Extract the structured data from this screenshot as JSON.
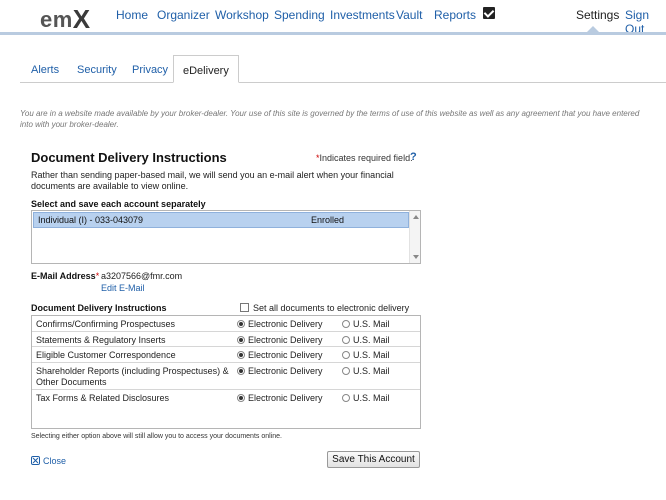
{
  "brand": {
    "logo_text": "em",
    "logo_x": "X"
  },
  "nav": {
    "home": "Home",
    "organizer": "Organizer",
    "workshop": "Workshop",
    "spending": "Spending",
    "investments": "Investments",
    "vault": "Vault",
    "reports": "Reports",
    "settings": "Settings",
    "signout": "Sign Out"
  },
  "tabs": {
    "alerts": "Alerts",
    "security": "Security",
    "privacy": "Privacy",
    "edelivery": "eDelivery"
  },
  "disclaimer": "You are in a website made available by your broker-dealer. Your use of this site is governed by the terms of use of this website as well as any agreement that you have entered into with your broker-dealer.",
  "panel": {
    "title": "Document Delivery Instructions",
    "required_star": "*",
    "required_text": "Indicates required field.",
    "help": "?",
    "intro": "Rather than sending paper-based mail, we will send you an e-mail alert when your financial documents are available to view online."
  },
  "accounts": {
    "heading": "Select and save each account separately",
    "items": [
      {
        "name": "Individual (I) - 033-043079",
        "status": "Enrolled"
      }
    ]
  },
  "email": {
    "label": "E-Mail Address",
    "star": "*",
    "value": "a3207566@fmr.com",
    "edit": "Edit E-Mail"
  },
  "delivery": {
    "heading": "Document Delivery Instructions",
    "set_all": "Set all documents to electronic delivery",
    "electronic_label": "Electronic Delivery",
    "mail_label": "U.S. Mail",
    "rows": [
      {
        "name": "Confirms/Confirming Prospectuses",
        "selected": "electronic"
      },
      {
        "name": "Statements & Regulatory Inserts",
        "selected": "electronic"
      },
      {
        "name": "Eligible Customer Correspondence",
        "selected": "electronic"
      },
      {
        "name": "Shareholder Reports (including Prospectuses) & Other Documents",
        "selected": "electronic"
      },
      {
        "name": "Tax Forms & Related Disclosures",
        "selected": "electronic"
      }
    ]
  },
  "footnote": "Selecting either option above will still allow you to access your documents online.",
  "actions": {
    "close": "Close",
    "save": "Save This Account"
  },
  "colors": {
    "link": "#1f5fa8",
    "selection": "#b8d1ef",
    "nav_line": "#b9cbe0",
    "required": "#cc0000"
  }
}
